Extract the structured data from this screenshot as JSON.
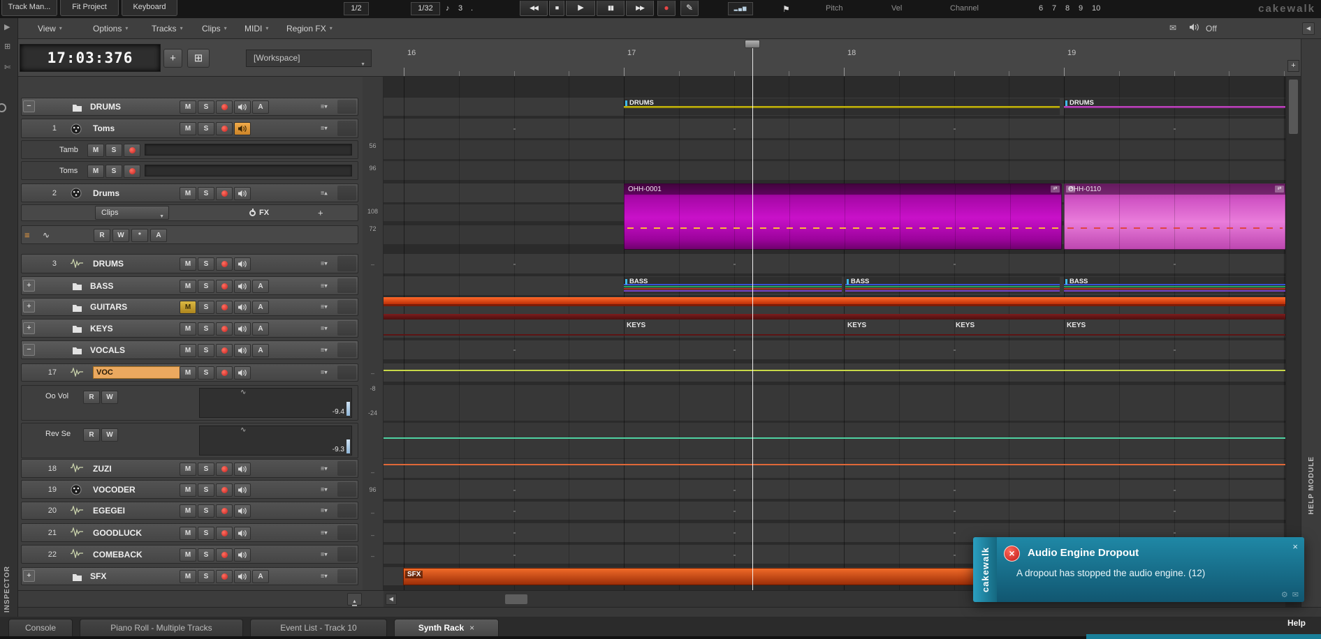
{
  "colors": {
    "accent_orange": "#e8a95c",
    "record_red": "#e04545",
    "clip_magenta": "#cc10cc",
    "clip_pink": "#e862d8",
    "notification_teal": "#1d84a3",
    "sfx_orange": "#e85a20",
    "keys_maroon": "#701818",
    "voc_line_yellow": "#c8d848"
  },
  "icons": {
    "rewind": "◀◀",
    "stop": "■",
    "play": "▶",
    "pause": "▮▮",
    "forward": "▶▶",
    "record": "●",
    "pencil": "✎",
    "note": "♪",
    "meter_bars": "▂▄▆",
    "flag": "⚑",
    "dropdown": "▼",
    "menu_arrow": "▾",
    "close": "×",
    "lane_arrow": "≡▾",
    "lane_arrow_up": "≡▴",
    "left_arrow": "◀",
    "up_arrow": "▲",
    "plus": "+",
    "grid": "⊞",
    "wave": "∿",
    "gear": "⚙",
    "mail": "✉",
    "swap": "⇄",
    "grip": "≡",
    "scissors": "✄",
    "dash": "–"
  },
  "top_toolbar": {
    "tabs": [
      "Track Man...",
      "Fit Project",
      "Keyboard"
    ],
    "snap_value": "1/2",
    "grid_value": "1/32",
    "note_count": "3",
    "dot": ".",
    "midi_labels": [
      "Pitch",
      "Vel",
      "Channel"
    ],
    "numbers": [
      "6",
      "7",
      "8",
      "9",
      "10"
    ],
    "brand": "cakewalk"
  },
  "menubar": {
    "items": [
      "View",
      "Options",
      "Tracks",
      "Clips",
      "MIDI",
      "Region FX"
    ],
    "echo_label": "Off"
  },
  "header": {
    "time_display": "17:03:376",
    "workspace": "[Workspace]"
  },
  "ruler": {
    "ticks": [
      "16",
      "17",
      "18",
      "19"
    ]
  },
  "track_buttons": {
    "mute": "M",
    "solo": "S",
    "archive": "A",
    "read": "R",
    "write": "W",
    "star": "*",
    "fx": "FX",
    "clips_dropdown": "Clips"
  },
  "tracks": [
    {
      "kind": "folder",
      "expander": "−",
      "name": "DRUMS"
    },
    {
      "kind": "track",
      "num": "1",
      "icon": "drum",
      "name": "Toms",
      "echo_highlight": true
    },
    {
      "kind": "lane",
      "name": "Tamb"
    },
    {
      "kind": "lane",
      "name": "Toms"
    },
    {
      "kind": "track",
      "num": "2",
      "icon": "drum",
      "name": "Drums",
      "arrow_up": true
    },
    {
      "kind": "cliprow"
    },
    {
      "kind": "autorow"
    },
    {
      "kind": "track",
      "num": "3",
      "icon": "wave",
      "name": "DRUMS"
    },
    {
      "kind": "folder",
      "expander": "+",
      "name": "BASS"
    },
    {
      "kind": "folder",
      "expander": "+",
      "name": "GUITARS",
      "muted": true
    },
    {
      "kind": "folder",
      "expander": "+",
      "name": "KEYS"
    },
    {
      "kind": "folder",
      "expander": "−",
      "name": "VOCALS"
    },
    {
      "kind": "track",
      "num": "17",
      "icon": "wave",
      "name": "VOC",
      "selected": true
    },
    {
      "kind": "autolane",
      "name": "Oo Vol",
      "value": "-9.4"
    },
    {
      "kind": "autolane",
      "name": "Rev Se",
      "value": "-9.3"
    },
    {
      "kind": "track",
      "num": "18",
      "icon": "wave",
      "name": "ZUZI"
    },
    {
      "kind": "track",
      "num": "19",
      "icon": "drum",
      "name": "VOCODER"
    },
    {
      "kind": "track",
      "num": "20",
      "icon": "wave",
      "name": "EGEGEI"
    },
    {
      "kind": "track",
      "num": "21",
      "icon": "wave",
      "name": "GOODLUCK"
    },
    {
      "kind": "track",
      "num": "22",
      "icon": "wave",
      "name": "COMEBACK"
    },
    {
      "kind": "folder",
      "expander": "+",
      "name": "SFX"
    }
  ],
  "meter_scale": [
    {
      "value": "56"
    },
    {
      "value": "96"
    },
    {
      "value": "108"
    },
    {
      "value": "72"
    },
    {
      "value": "-8"
    },
    {
      "value": "-24"
    },
    {
      "value": "96"
    }
  ],
  "clips": {
    "drums_a_label": "DRUMS",
    "drums_b_label": "DRUMS",
    "ohh_a_label": "OHH-0001",
    "ohh_b_label": "OHH-0110",
    "bass_label": "BASS",
    "keys_label": "KEYS",
    "sfx_label": "SFX"
  },
  "notification": {
    "brand": "cakewalk",
    "title": "Audio Engine Dropout",
    "message": "A dropout has stopped the audio engine. (12)"
  },
  "bottom_bar": {
    "tabs": [
      "Console",
      "Piano Roll - Multiple Tracks",
      "Event List - Track 10",
      "Synth Rack"
    ],
    "active_tab": "Synth Rack",
    "help": "Help"
  },
  "side_panels": {
    "right": "HELP MODULE",
    "left": "INSPECTOR"
  }
}
